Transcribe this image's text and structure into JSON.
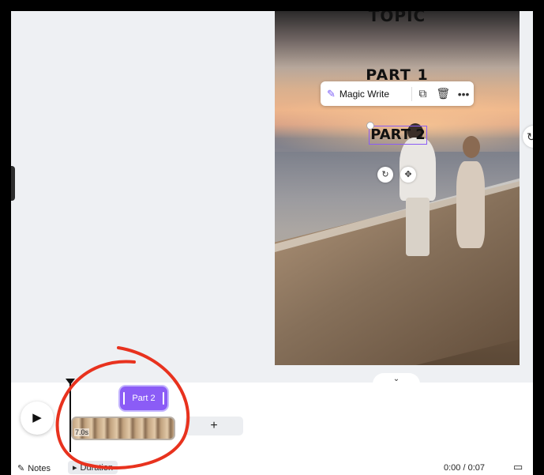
{
  "design": {
    "title_top": "TOPIC",
    "part1": "PART 1",
    "part2": "PART 2"
  },
  "toolbar": {
    "magic_write_label": "Magic Write",
    "magic_write_icon": "magic-wand-icon",
    "duplicate_icon": "duplicate-icon",
    "delete_icon": "trash-icon",
    "more_label": "•••"
  },
  "timeline": {
    "text_clip_label": "Part 2",
    "video_clip_duration": "7.0s",
    "add_label": "+",
    "play_glyph": "▶",
    "collapse_glyph": "⌄"
  },
  "bottom_bar": {
    "notes_label": "Notes",
    "duration_label": "Duration",
    "time_readout": "0:00 / 0:07"
  },
  "accent_colors": {
    "selection": "#8b5cf6",
    "annotation": "#e8321e"
  }
}
